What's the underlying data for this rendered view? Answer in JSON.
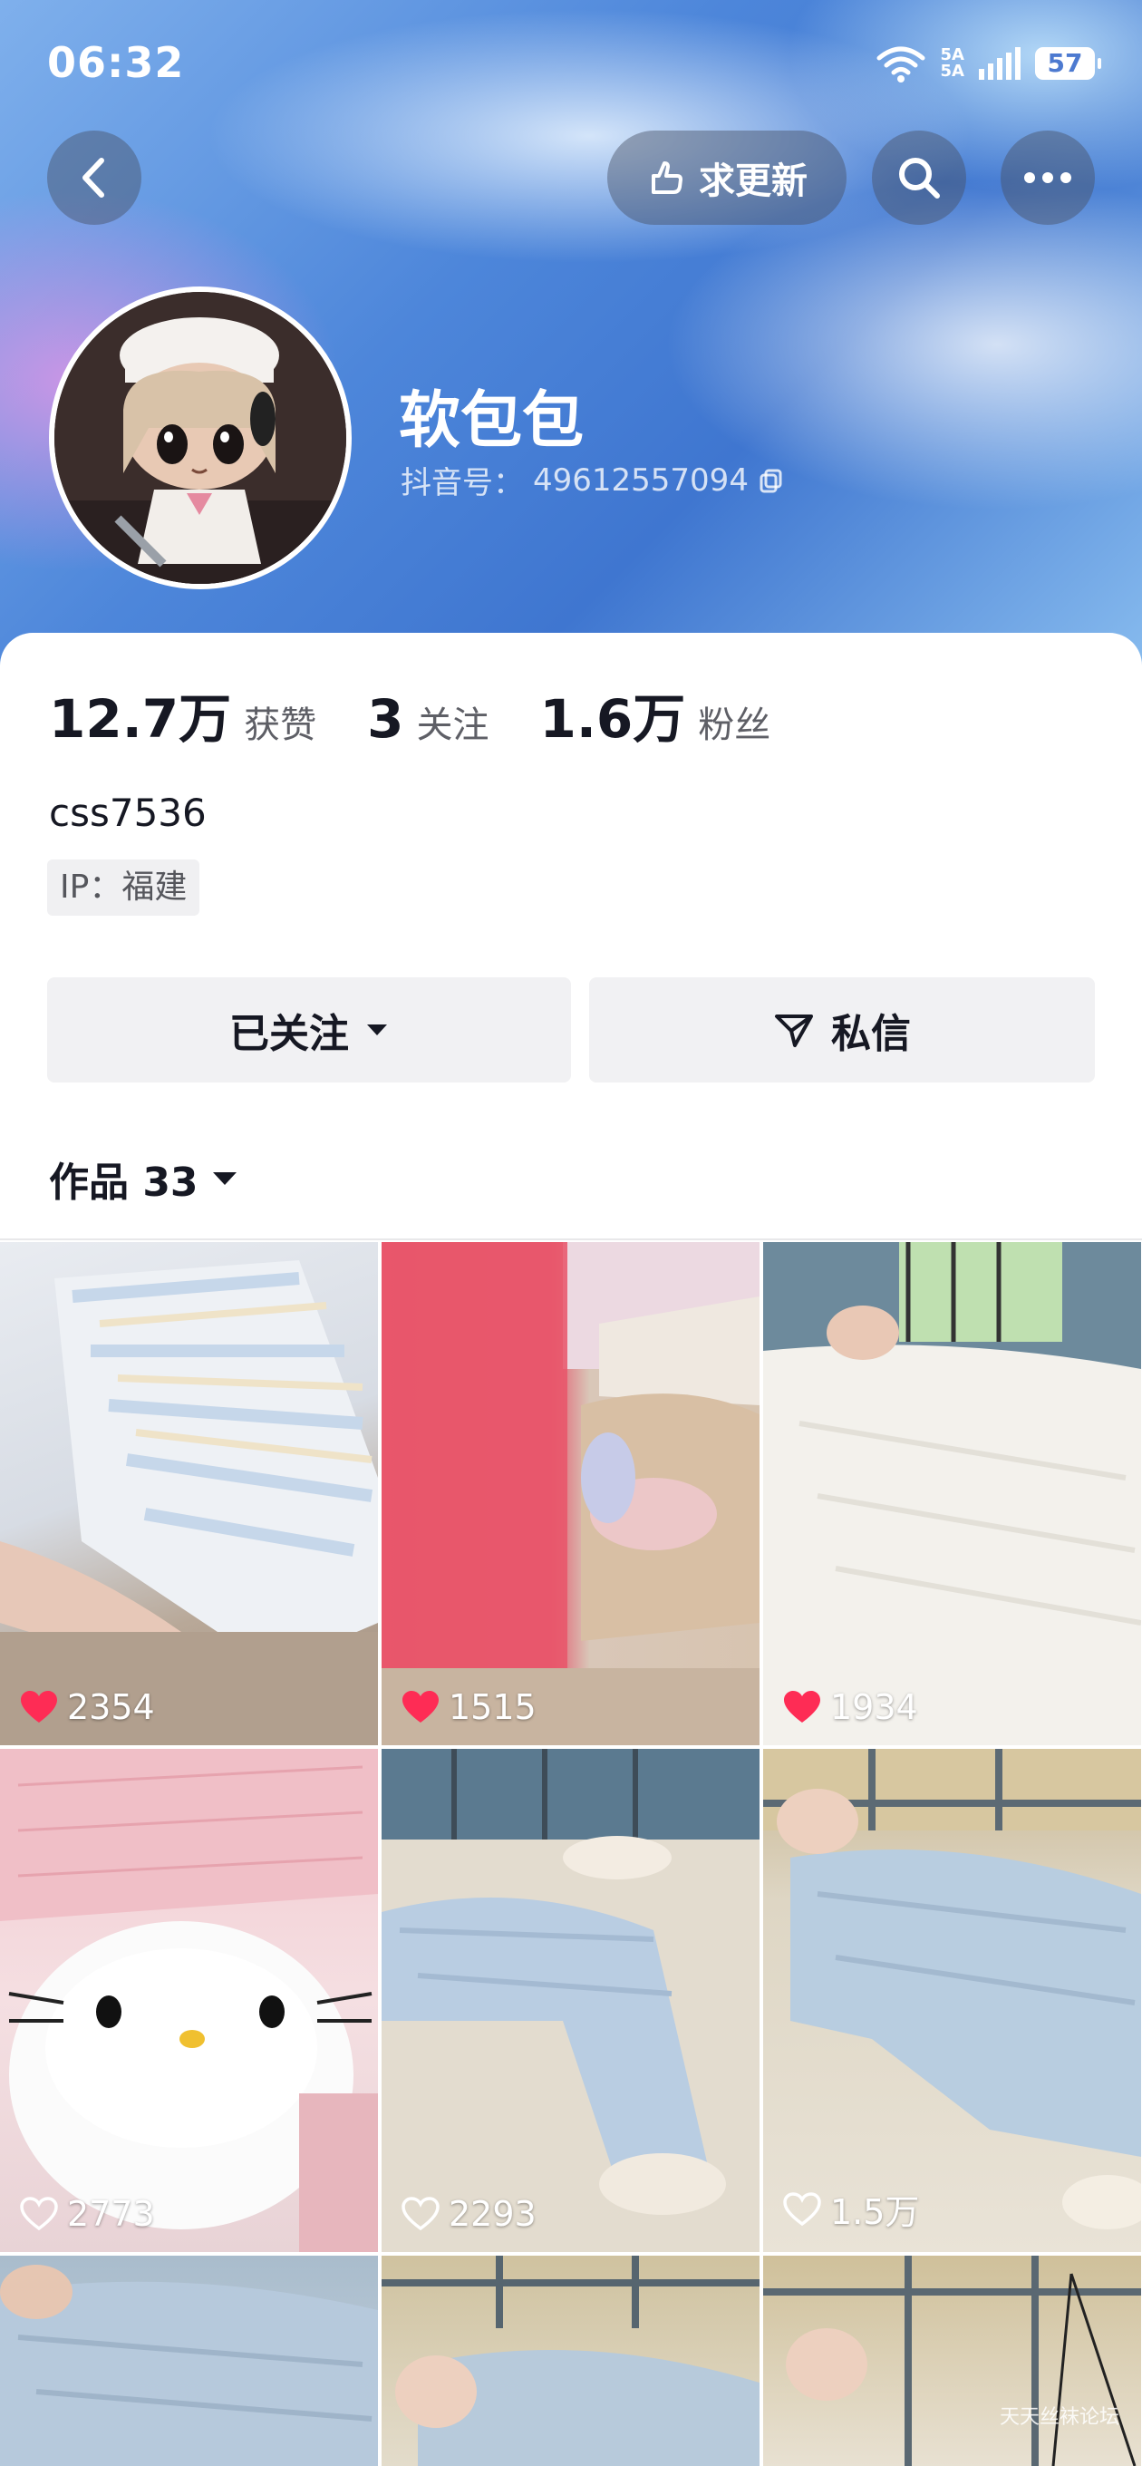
{
  "status_bar": {
    "time": "06:32",
    "network_top": "5A",
    "network_bottom": "5A",
    "battery": "57"
  },
  "header": {
    "update_button": "求更新"
  },
  "profile": {
    "nickname": "软包包",
    "douyin_id_label": "抖音号：",
    "douyin_id": "49612557094",
    "avatar_icon": "anime-chef-girl-avatar"
  },
  "stats": {
    "likes_num": "12.7万",
    "likes_label": "获赞",
    "following_num": "3",
    "following_label": "关注",
    "followers_num": "1.6万",
    "followers_label": "粉丝"
  },
  "bio": {
    "handle": "css7536",
    "ip": "IP：福建"
  },
  "actions": {
    "followed": "已关注",
    "message": "私信"
  },
  "works": {
    "label": "作品 33"
  },
  "videos": [
    {
      "likes": "2354",
      "liked": true
    },
    {
      "likes": "1515",
      "liked": true
    },
    {
      "likes": "1934",
      "liked": true
    },
    {
      "likes": "2773",
      "liked": false
    },
    {
      "likes": "2293",
      "liked": false
    },
    {
      "likes": "1.5万",
      "liked": false
    }
  ],
  "watermark": "天天丝袜论坛",
  "colors": {
    "like_red": "#fe2c55",
    "hero_blue": "#4d86da"
  }
}
